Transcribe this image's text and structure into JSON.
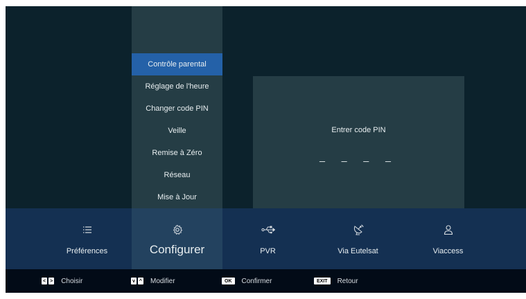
{
  "menu": {
    "items": [
      {
        "label": "Contrôle parental",
        "active": true
      },
      {
        "label": "Réglage de l'heure",
        "active": false
      },
      {
        "label": "Changer code PIN",
        "active": false
      },
      {
        "label": "Veille",
        "active": false
      },
      {
        "label": "Remise à Zéro",
        "active": false
      },
      {
        "label": "Réseau",
        "active": false
      },
      {
        "label": "Mise à Jour",
        "active": false
      }
    ]
  },
  "pin_panel": {
    "label": "Entrer code PIN",
    "dashes": "_ _ _ _"
  },
  "tabs": [
    {
      "label": "Préférences",
      "icon": "list-icon",
      "active": false
    },
    {
      "label": "Configurer",
      "icon": "gear-icon",
      "active": true
    },
    {
      "label": "PVR",
      "icon": "usb-icon",
      "active": false
    },
    {
      "label": "Via Eutelsat",
      "icon": "satellite-dish-icon",
      "active": false
    },
    {
      "label": "Viaccess",
      "icon": "user-icon",
      "active": false
    }
  ],
  "footer": {
    "hints": [
      {
        "keys": [
          "<",
          ">"
        ],
        "label": "Choisir"
      },
      {
        "keys": [
          "v",
          "^"
        ],
        "label": "Modifier"
      },
      {
        "keys": [
          "OK"
        ],
        "label": "Confirmer"
      },
      {
        "keys": [
          "EXIT"
        ],
        "label": "Retour"
      }
    ]
  },
  "colors": {
    "background": "#0c222c",
    "panel": "#253d45",
    "accent": "#2461a8",
    "bottom_bar": "#143052",
    "footer": "#020b17"
  }
}
